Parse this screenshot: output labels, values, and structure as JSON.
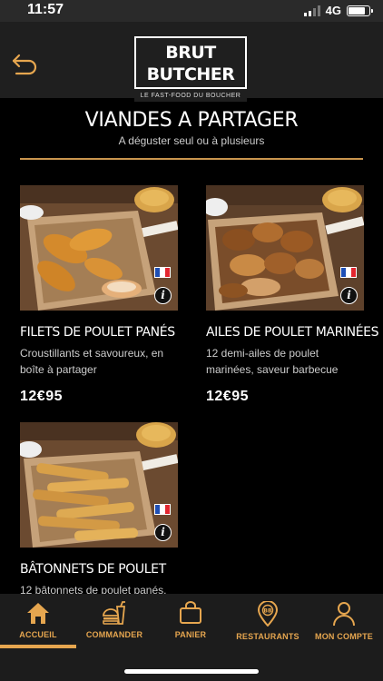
{
  "status_bar": {
    "time": "11:57",
    "network": "4G"
  },
  "header": {
    "logo_text": "BRUT BUTCHER",
    "logo_tagline": "LE FAST-FOOD DU BOUCHER"
  },
  "section": {
    "title": "VIANDES A PARTAGER",
    "subtitle": "A déguster seul ou à plusieurs"
  },
  "products": [
    {
      "name": "FILETS DE POULET PANÉS",
      "description": "Croustillants et savoureux, en boîte à partager",
      "price": "12€95"
    },
    {
      "name": "AILES DE POULET MARINÉES",
      "description": "12 demi-ailes de poulet marinées, saveur barbecue",
      "price": "12€95"
    },
    {
      "name": "BÂTONNETS DE POULET",
      "description": "12 bâtonnets de poulet panés,"
    }
  ],
  "nav": [
    {
      "label": "ACCUEIL",
      "icon": "home-icon",
      "active": true
    },
    {
      "label": "COMMANDER",
      "icon": "burger-drink-icon"
    },
    {
      "label": "PANIER",
      "icon": "bag-icon"
    },
    {
      "label": "RESTAURANTS",
      "icon": "map-pin-icon"
    },
    {
      "label": "MON COMPTE",
      "icon": "user-icon"
    }
  ],
  "colors": {
    "accent": "#e6a64f",
    "divider": "#c9954e",
    "background": "#000000",
    "header": "#1f1f1f"
  }
}
